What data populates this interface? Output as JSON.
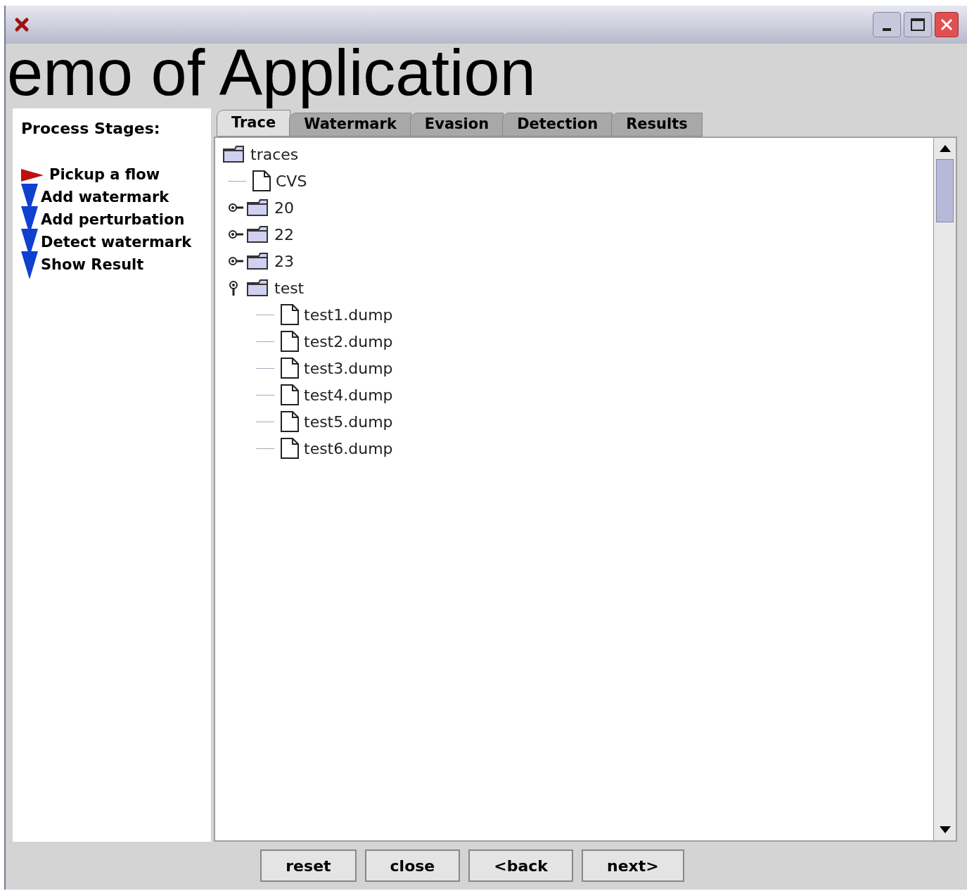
{
  "overlay_title": "emo of Application",
  "stages": {
    "heading": "Process Stages:",
    "items": [
      {
        "label": "Pickup a flow",
        "selected": true
      },
      {
        "label": "Add watermark",
        "selected": false
      },
      {
        "label": "Add perturbation",
        "selected": false
      },
      {
        "label": "Detect watermark",
        "selected": false
      },
      {
        "label": "Show Result",
        "selected": false
      }
    ]
  },
  "tabs": [
    {
      "label": "Trace",
      "selected": true
    },
    {
      "label": "Watermark",
      "selected": false
    },
    {
      "label": "Evasion",
      "selected": false
    },
    {
      "label": "Detection",
      "selected": false
    },
    {
      "label": "Results",
      "selected": false
    }
  ],
  "tree": {
    "label": "traces",
    "kind": "folder",
    "children": [
      {
        "label": "CVS",
        "kind": "file"
      },
      {
        "label": "20",
        "kind": "folder",
        "expanded": false
      },
      {
        "label": "22",
        "kind": "folder",
        "expanded": false
      },
      {
        "label": "23",
        "kind": "folder",
        "expanded": false
      },
      {
        "label": "test",
        "kind": "folder",
        "expanded": true,
        "children": [
          {
            "label": "test1.dump",
            "kind": "file"
          },
          {
            "label": "test2.dump",
            "kind": "file"
          },
          {
            "label": "test3.dump",
            "kind": "file"
          },
          {
            "label": "test4.dump",
            "kind": "file"
          },
          {
            "label": "test5.dump",
            "kind": "file"
          },
          {
            "label": "test6.dump",
            "kind": "file"
          }
        ]
      }
    ]
  },
  "buttons": [
    "reset",
    "close",
    "<back",
    "next>"
  ]
}
